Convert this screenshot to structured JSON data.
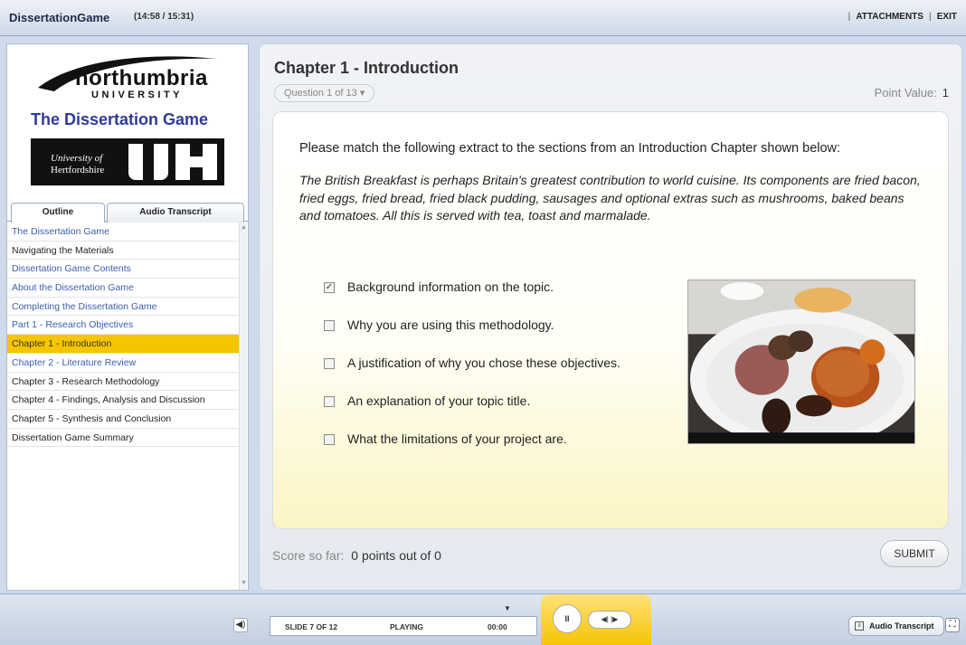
{
  "app": {
    "title": "DissertationGame",
    "timer": "(14:58 / 15:31)"
  },
  "top_links": {
    "attachments": "ATTACHMENTS",
    "exit": "EXIT"
  },
  "sidebar": {
    "logo": {
      "name": "northumbria",
      "sub": "UNIVERSITY"
    },
    "game_title": "The Dissertation Game",
    "uh_logo": {
      "line1": "University of",
      "line2": "Hertfordshire",
      "mark": "UH"
    },
    "tabs": [
      {
        "label": "Outline"
      },
      {
        "label": "Audio Transcript"
      }
    ],
    "outline": [
      {
        "label": "The Dissertation Game",
        "style": "link"
      },
      {
        "label": "Navigating the Materials",
        "style": "plain"
      },
      {
        "label": "Dissertation Game Contents",
        "style": "link"
      },
      {
        "label": "About the Dissertation Game",
        "style": "link"
      },
      {
        "label": "Completing the Dissertation Game",
        "style": "link"
      },
      {
        "label": "Part 1 - Research Objectives",
        "style": "link"
      },
      {
        "label": "Chapter 1 - Introduction",
        "style": "active"
      },
      {
        "label": "Chapter 2 - Literature Review",
        "style": "link"
      },
      {
        "label": "Chapter 3 - Research Methodology",
        "style": "plain"
      },
      {
        "label": "Chapter 4 - Findings, Analysis and Discussion",
        "style": "plain"
      },
      {
        "label": "Chapter 5 - Synthesis and Conclusion",
        "style": "plain"
      },
      {
        "label": "Dissertation Game Summary",
        "style": "plain"
      }
    ]
  },
  "main": {
    "chapter_title": "Chapter 1 - Introduction",
    "question_selector": "Question 1 of 13  ▾",
    "point_value_label": "Point Value:",
    "point_value": "1",
    "prompt": "Please match the following extract to the sections from an Introduction Chapter shown below:",
    "extract": "The British Breakfast is perhaps Britain's greatest contribution to world cuisine. Its components are fried bacon, fried eggs, fried bread, fried black pudding, sausages and optional extras such as mushrooms, baked beans and tomatoes. All this is served with tea, toast and marmalade.",
    "options": [
      {
        "label": "Background information on the topic.",
        "checked": true
      },
      {
        "label": "Why you are using this methodology.",
        "checked": false
      },
      {
        "label": "A justification of why you chose these objectives.",
        "checked": false
      },
      {
        "label": "An explanation of your topic title.",
        "checked": false
      },
      {
        "label": "What the limitations of your project are.",
        "checked": false
      }
    ],
    "score_label": "Score so far:",
    "score_value": "0 points out of 0",
    "submit_label": "SUBMIT"
  },
  "player": {
    "slide": "SLIDE 7 OF 12",
    "status": "PLAYING",
    "time": "00:00",
    "pause_icon": "II",
    "seek_icon": "◀| |▶",
    "transcript_button": "Audio Transcript"
  },
  "colors": {
    "accent_yellow": "#f5c500",
    "link_blue": "#3a5cb0",
    "title_navy": "#2f3a96"
  }
}
